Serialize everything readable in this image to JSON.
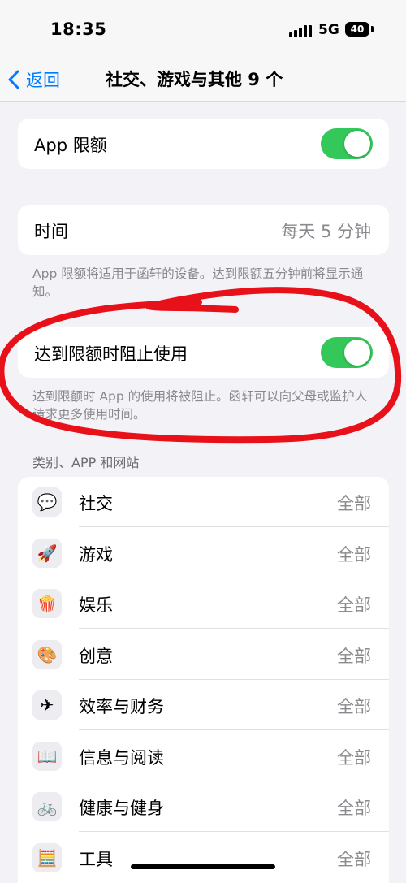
{
  "status_bar": {
    "time": "18:35",
    "network": "5G",
    "battery": "40"
  },
  "nav": {
    "back_label": "返回",
    "title": "社交、游戏与其他 9 个"
  },
  "app_limit": {
    "label": "App 限额",
    "enabled": true
  },
  "time_setting": {
    "label": "时间",
    "value": "每天 5 分钟"
  },
  "time_footnote": "App 限额将适用于函轩的设备。达到限额五分钟前将显示通知。",
  "block_at_limit": {
    "label": "达到限额时阻止使用",
    "enabled": true
  },
  "block_footnote": "达到限额时 App 的使用将被阻止。函轩可以向父母或监护人请求更多使用时间。",
  "categories_header": "类别、APP 和网站",
  "categories": [
    {
      "label": "社交",
      "value": "全部",
      "icon": "social-icon",
      "glyph": "💬"
    },
    {
      "label": "游戏",
      "value": "全部",
      "icon": "rocket-icon",
      "glyph": "🚀"
    },
    {
      "label": "娱乐",
      "value": "全部",
      "icon": "popcorn-icon",
      "glyph": "🍿"
    },
    {
      "label": "创意",
      "value": "全部",
      "icon": "palette-icon",
      "glyph": "🎨"
    },
    {
      "label": "效率与财务",
      "value": "全部",
      "icon": "paper-plane-icon",
      "glyph": "✈"
    },
    {
      "label": "信息与阅读",
      "value": "全部",
      "icon": "book-icon",
      "glyph": "📖"
    },
    {
      "label": "健康与健身",
      "value": "全部",
      "icon": "bicycle-icon",
      "glyph": "🚲"
    },
    {
      "label": "工具",
      "value": "全部",
      "icon": "calculator-icon",
      "glyph": "🧮"
    }
  ],
  "colors": {
    "accent": "#007aff",
    "toggle_on": "#34c759",
    "annotation": "#e8111a"
  }
}
